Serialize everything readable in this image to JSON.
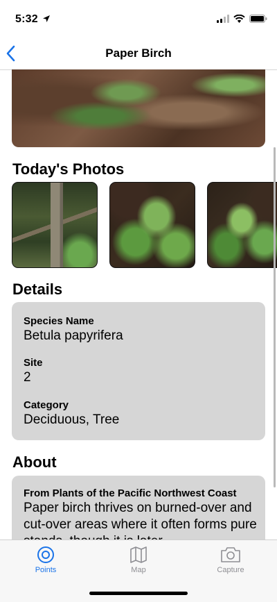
{
  "status_bar": {
    "time": "5:32"
  },
  "nav": {
    "title": "Paper Birch",
    "back_icon": "chevron-left-icon"
  },
  "photos": {
    "section_title": "Today's Photos"
  },
  "details": {
    "section_title": "Details",
    "fields": [
      {
        "label": "Species Name",
        "value": "Betula papyrifera"
      },
      {
        "label": "Site",
        "value": "2"
      },
      {
        "label": "Category",
        "value": "Deciduous, Tree"
      }
    ]
  },
  "about": {
    "section_title": "About",
    "source": "From Plants of the Pacific Northwest Coast",
    "text": "Paper birch thrives on burned-over and cut-over areas where it often forms pure stands, though it is later"
  },
  "tab_bar": {
    "tabs": [
      {
        "label": "Points",
        "icon": "target-icon",
        "selected": true
      },
      {
        "label": "Map",
        "icon": "map-icon",
        "selected": false
      },
      {
        "label": "Capture",
        "icon": "camera-icon",
        "selected": false
      }
    ]
  },
  "colors": {
    "accent": "#1a73e8",
    "card_background": "#d6d6d6",
    "inactive_tab": "#8e8e93"
  }
}
